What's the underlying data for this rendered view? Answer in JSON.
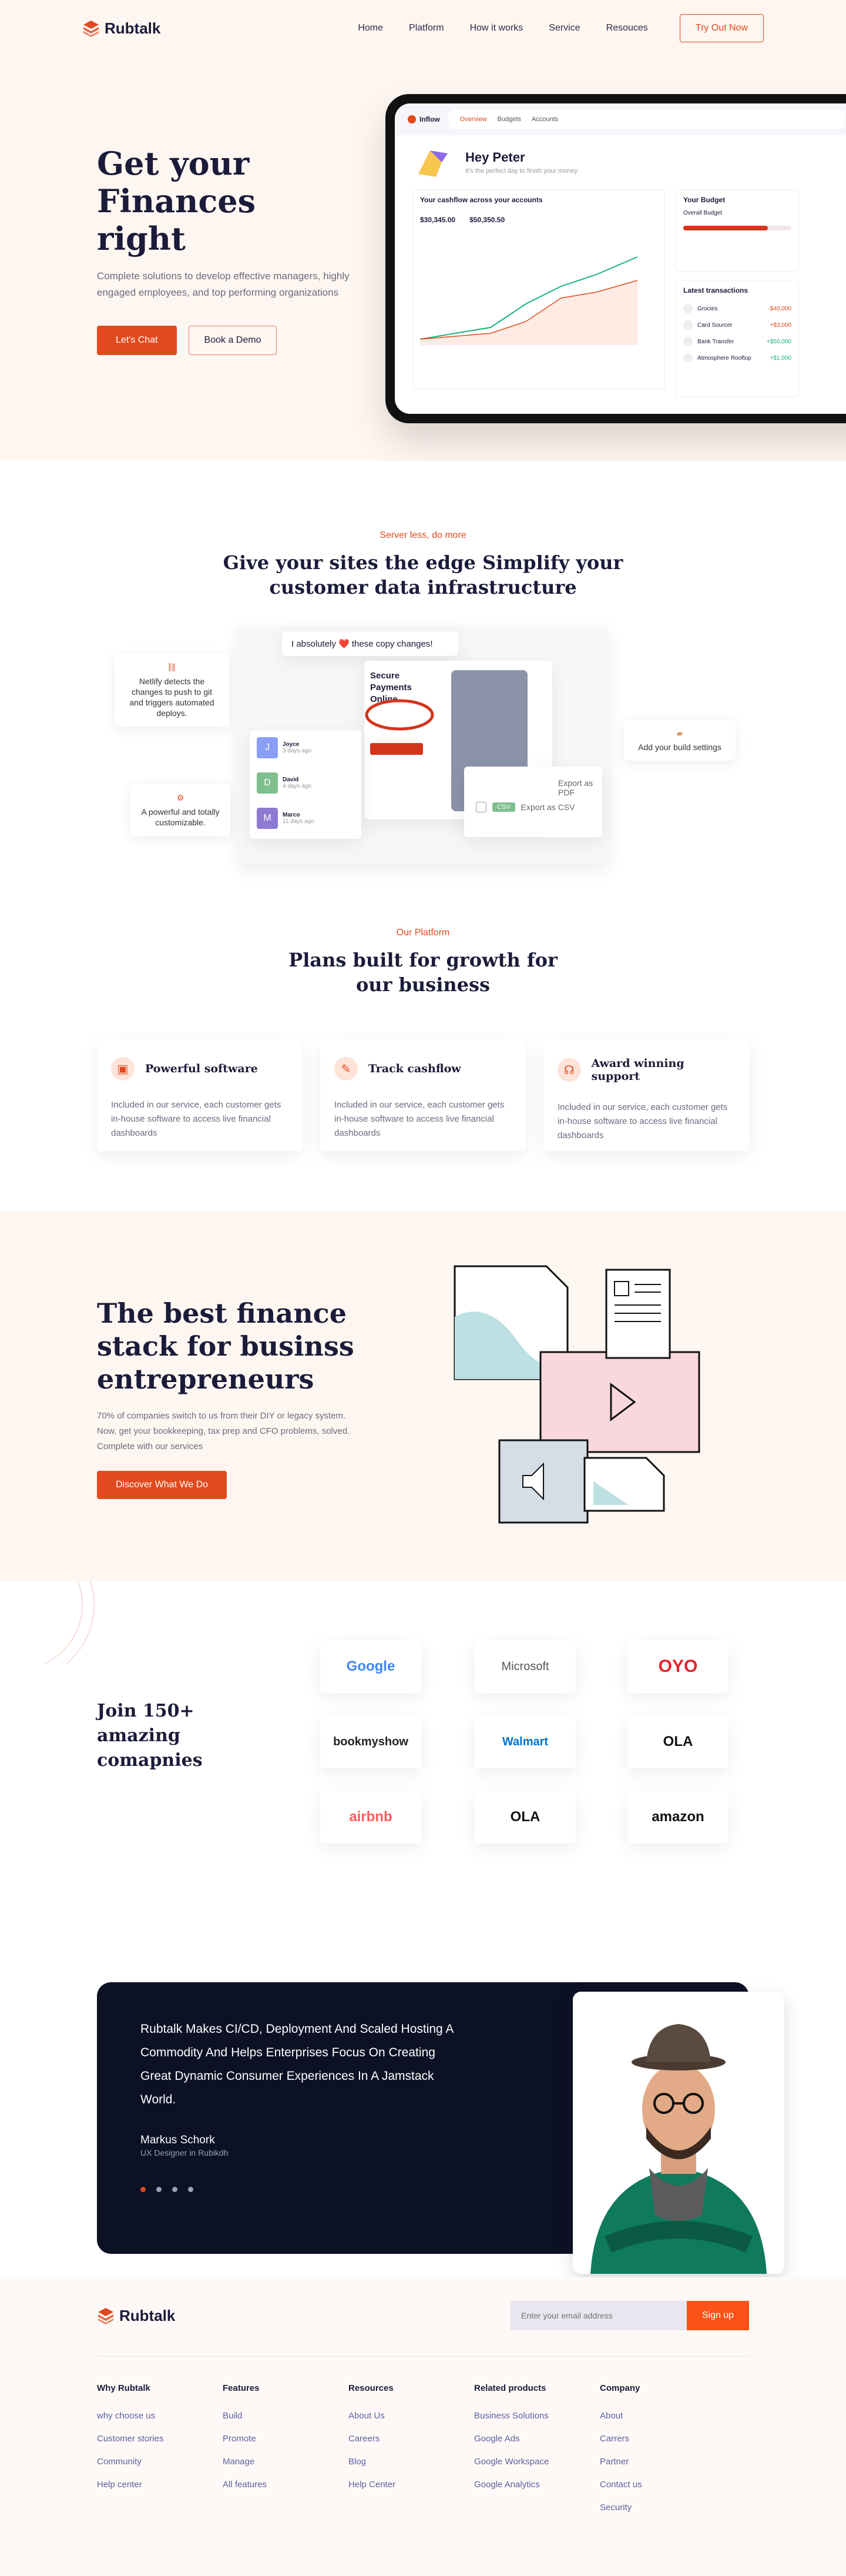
{
  "brand": {
    "name": "Rubtalk",
    "accent": "#e04a1e",
    "dark": "#1b1b3a"
  },
  "nav": {
    "links": [
      "Home",
      "Platform",
      "How it works",
      "Service",
      "Resouces"
    ],
    "cta": "Try Out Now"
  },
  "hero": {
    "title_line1": "Get your",
    "title_line2": "Finances right",
    "subtitle": "Complete solutions to develop effective managers, highly engaged employees, and top performing organizations",
    "primary_btn": "Let's Chat",
    "secondary_btn": "Book a Demo"
  },
  "dashboard": {
    "app_name": "Inflow",
    "tabs": [
      "Overview",
      "Budgets",
      "Accounts"
    ],
    "greeting": "Hey Peter",
    "greeting_sub": "It's the perfect day to finish your money",
    "cashflow_title": "Your cashflow across your accounts",
    "amount1": "$30,345.00",
    "amount2": "$50,350.50",
    "budget_title": "Your Budget",
    "overall_budget": "Overall Budget",
    "tx_title": "Latest transactions",
    "transactions": [
      {
        "name": "Grocies",
        "amount": "-$40,000"
      },
      {
        "name": "Card Sourcer",
        "amount": "+$3,000"
      },
      {
        "name": "Bank Transfer",
        "amount": "+$50,000"
      },
      {
        "name": "Atmosphere Rooftop",
        "amount": "+$1,000"
      }
    ]
  },
  "server": {
    "eyebrow": "Server less, do more",
    "title_line1": "Give your sites the edge Simplify your",
    "title_line2": "customer data infrastructure",
    "bubble": "I absolutely ❤️ these copy changes!",
    "note_left": "Netlify detects the changes to push to git and triggers automated deploys.",
    "note_bottom": "A powerful and totally customizable.",
    "note_right": "Add your build settings",
    "secure_title": "Secure Payments Online",
    "users": [
      {
        "initial": "J",
        "name": "Joyce",
        "when": "3 days ago"
      },
      {
        "initial": "D",
        "name": "David",
        "when": "4 days ago"
      },
      {
        "initial": "M",
        "name": "Marco",
        "when": "11 days ago"
      }
    ],
    "export_pdf": "Export as PDF",
    "export_csv": "Export as CSV",
    "csv_badge": "CSV"
  },
  "platform": {
    "eyebrow": "Our Platform",
    "title_line1": "Plans built for growth for",
    "title_line2": "our business",
    "cards": [
      {
        "title": "Powerful software",
        "text": "Included in our service, each customer gets in-house software to access live financial dashboards"
      },
      {
        "title": "Track cashflow",
        "text": "Included in our service, each customer gets in-house software to access live financial dashboards"
      },
      {
        "title": "Award winning support",
        "text": "Included in our service, each customer gets in-house software to access live financial dashboards"
      }
    ]
  },
  "finance": {
    "title_line1": "The best finance",
    "title_line2": "stack for businss",
    "title_line3": "entrepreneurs",
    "subtitle": "70% of companies switch to us from their DIY or legacy system. Now, get your bookkeeping, tax prep and CFO problems, solved. Complete with our services",
    "button": "Discover What We Do"
  },
  "join": {
    "title": "Join 150+ amazing comapnies",
    "companies": [
      "Google",
      "Microsoft",
      "OYO",
      "bookmyshow",
      "Walmart",
      "OLA",
      "airbnb",
      "OLA",
      "amazon"
    ]
  },
  "testimonial": {
    "quote": "Rubtalk Makes CI/CD, Deployment And Scaled Hosting A Commodity And Helps Enterprises Focus On Creating Great Dynamic Consumer Experiences In A Jamstack World.",
    "name": "Markus Schork",
    "role": "UX Designer in Rubikdh"
  },
  "footer": {
    "email_placeholder": "Enter your email address",
    "signup": "Sign up",
    "columns": [
      {
        "title": "Why Rubtalk",
        "links": [
          "why choose us",
          "Customer stories",
          "Community",
          "Help center"
        ]
      },
      {
        "title": "Features",
        "links": [
          "Build",
          "Promote",
          "Manage",
          "All features"
        ]
      },
      {
        "title": "Resources",
        "links": [
          "About Us",
          "Careers",
          "Blog",
          "Help Center"
        ]
      },
      {
        "title": "Related products",
        "links": [
          "Business Solutions",
          "Google Ads",
          "Google Workspace",
          "Google Analytics"
        ]
      },
      {
        "title": "Company",
        "links": [
          "About",
          "Carrers",
          "Partner",
          "Contact us",
          "Security"
        ]
      }
    ]
  }
}
